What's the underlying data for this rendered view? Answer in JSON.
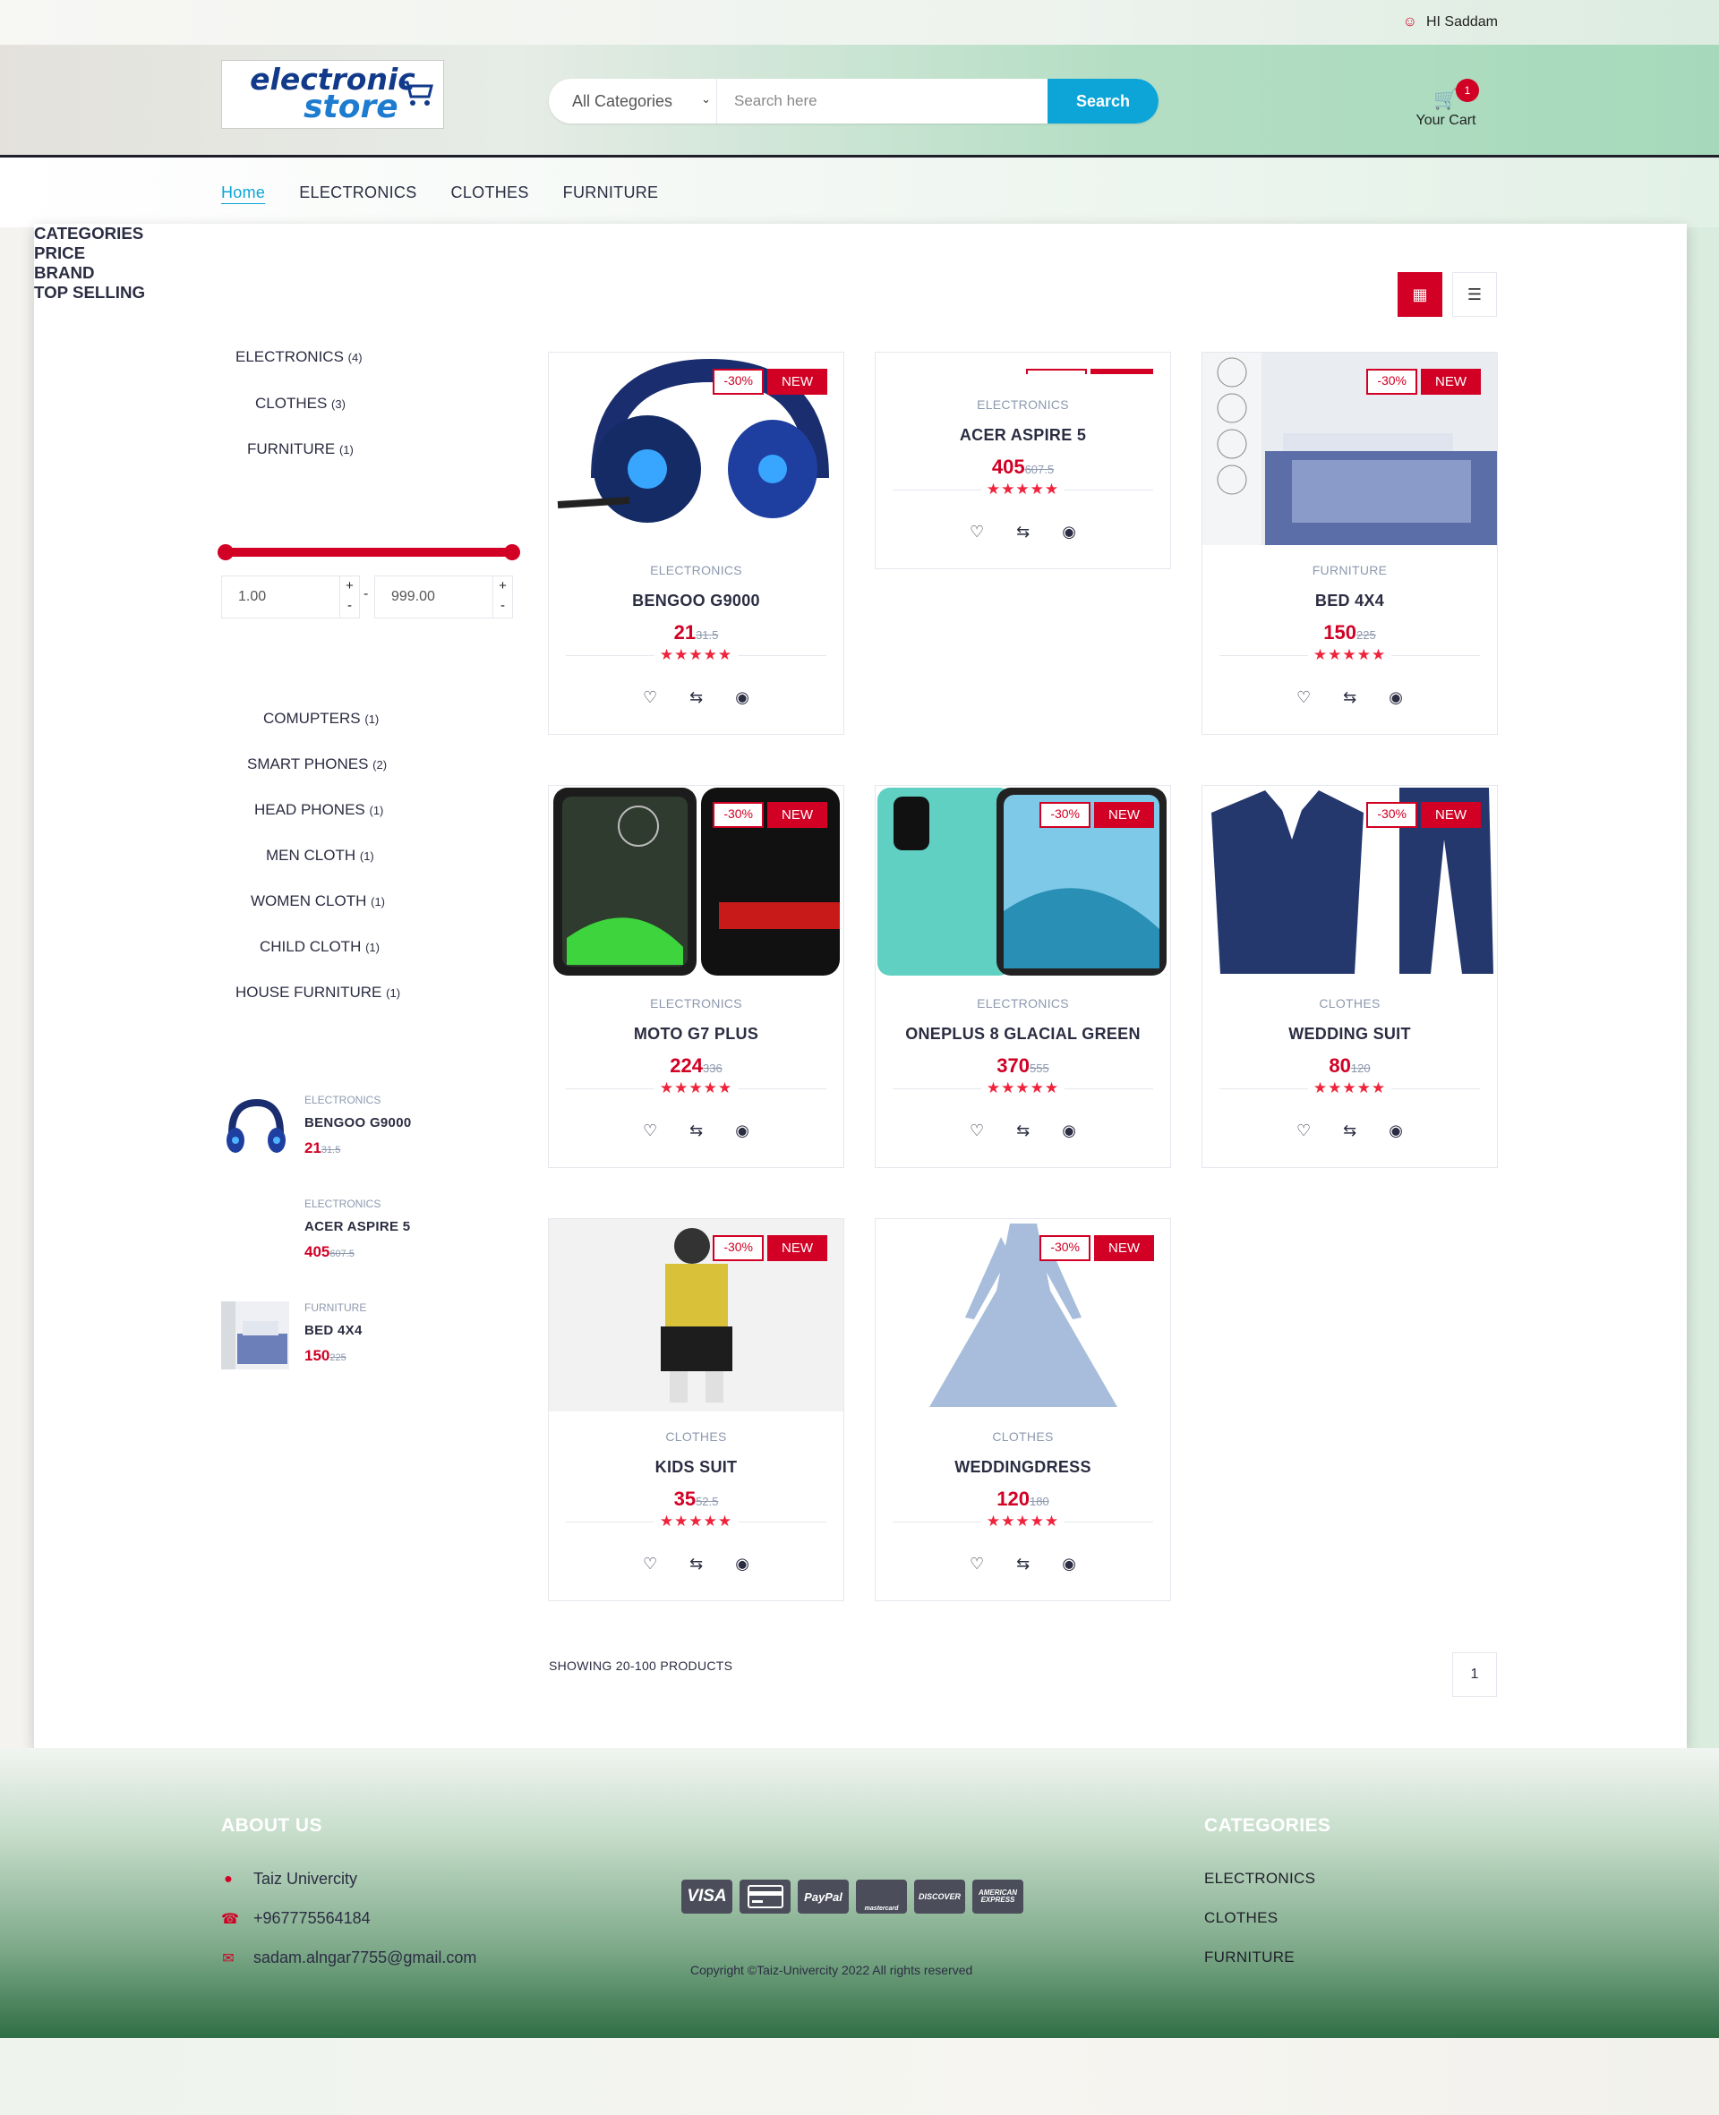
{
  "topbar": {
    "greeting": "HI Saddam"
  },
  "header": {
    "logo_line1": "electronic",
    "logo_line2": "store",
    "search": {
      "category_selected": "All Categories",
      "placeholder": "Search here",
      "button_label": "Search"
    },
    "cart": {
      "label": "Your Cart",
      "count": "1"
    }
  },
  "nav": {
    "items": [
      "Home",
      "ELECTRONICS",
      "CLOTHES",
      "FURNITURE"
    ]
  },
  "sidebar": {
    "categories_title": "CATEGORIES",
    "categories": [
      {
        "label": "ELECTRONICS",
        "count": "(4)"
      },
      {
        "label": "CLOTHES",
        "count": "(3)"
      },
      {
        "label": "FURNITURE",
        "count": "(1)"
      }
    ],
    "price_title": "PRICE",
    "price_min": "1.00",
    "price_max": "999.00",
    "price_dash": "-",
    "brand_title": "BRAND",
    "brands": [
      {
        "label": "COMUPTERS",
        "count": "(1)"
      },
      {
        "label": "SMART PHONES",
        "count": "(2)"
      },
      {
        "label": "HEAD PHONES",
        "count": "(1)"
      },
      {
        "label": "MEN CLOTH",
        "count": "(1)"
      },
      {
        "label": "WOMEN CLOTH",
        "count": "(1)"
      },
      {
        "label": "CHILD CLOTH",
        "count": "(1)"
      },
      {
        "label": "HOUSE FURNITURE",
        "count": "(1)"
      }
    ],
    "top_selling_title": "TOP SELLING",
    "top_selling": [
      {
        "category": "ELECTRONICS",
        "name": "BENGOO G9000",
        "price": "21",
        "old_price": "31.5"
      },
      {
        "category": "ELECTRONICS",
        "name": "ACER ASPIRE 5",
        "price": "405",
        "old_price": "607.5"
      },
      {
        "category": "FURNITURE",
        "name": "BED 4X4",
        "price": "150",
        "old_price": "225"
      }
    ]
  },
  "products": [
    {
      "category": "ELECTRONICS",
      "name": "BENGOO G9000",
      "price": "21",
      "old_price": "31.5",
      "sale": "-30%",
      "new": "NEW",
      "image": "headphones"
    },
    {
      "category": "ELECTRONICS",
      "name": "ACER ASPIRE 5",
      "price": "405",
      "old_price": "607.5",
      "sale": "",
      "new": "",
      "image": "none"
    },
    {
      "category": "FURNITURE",
      "name": "BED 4X4",
      "price": "150",
      "old_price": "225",
      "sale": "-30%",
      "new": "NEW",
      "image": "bed"
    },
    {
      "category": "ELECTRONICS",
      "name": "MOTO G7 PLUS",
      "price": "224",
      "old_price": "336",
      "sale": "-30%",
      "new": "NEW",
      "image": "moto"
    },
    {
      "category": "ELECTRONICS",
      "name": "ONEPLUS 8 GLACIAL GREEN",
      "price": "370",
      "old_price": "555",
      "sale": "-30%",
      "new": "NEW",
      "image": "oneplus"
    },
    {
      "category": "CLOTHES",
      "name": "WEDDING SUIT",
      "price": "80",
      "old_price": "120",
      "sale": "-30%",
      "new": "NEW",
      "image": "suit"
    },
    {
      "category": "CLOTHES",
      "name": "KIDS SUIT",
      "price": "35",
      "old_price": "52.5",
      "sale": "-30%",
      "new": "NEW",
      "image": "kids"
    },
    {
      "category": "CLOTHES",
      "name": "WEDDINGDRESS",
      "price": "120",
      "old_price": "180",
      "sale": "-30%",
      "new": "NEW",
      "image": "dress"
    }
  ],
  "rating_stars": "★★★★★",
  "showing_text": "SHOWING 20-100 PRODUCTS",
  "pagination": {
    "current": "1"
  },
  "footer": {
    "about_title": "ABOUT US",
    "address": "Taiz Univercity",
    "phone": "+967775564184",
    "email": "sadam.alngar7755@gmail.com",
    "payment_cards": [
      "VISA",
      "",
      "PayPal",
      "mastercard",
      "DISCOVER",
      "AMERICAN EXPRESS"
    ],
    "copyright": "Copyright ©Taiz-Univercity 2022 All rights reserved",
    "categories_title": "CATEGORIES",
    "categories": [
      "ELECTRONICS",
      "CLOTHES",
      "FURNITURE"
    ]
  },
  "colors": {
    "accent": "#d10024",
    "search_button": "#0da5d8",
    "dark": "#2b2d42"
  }
}
